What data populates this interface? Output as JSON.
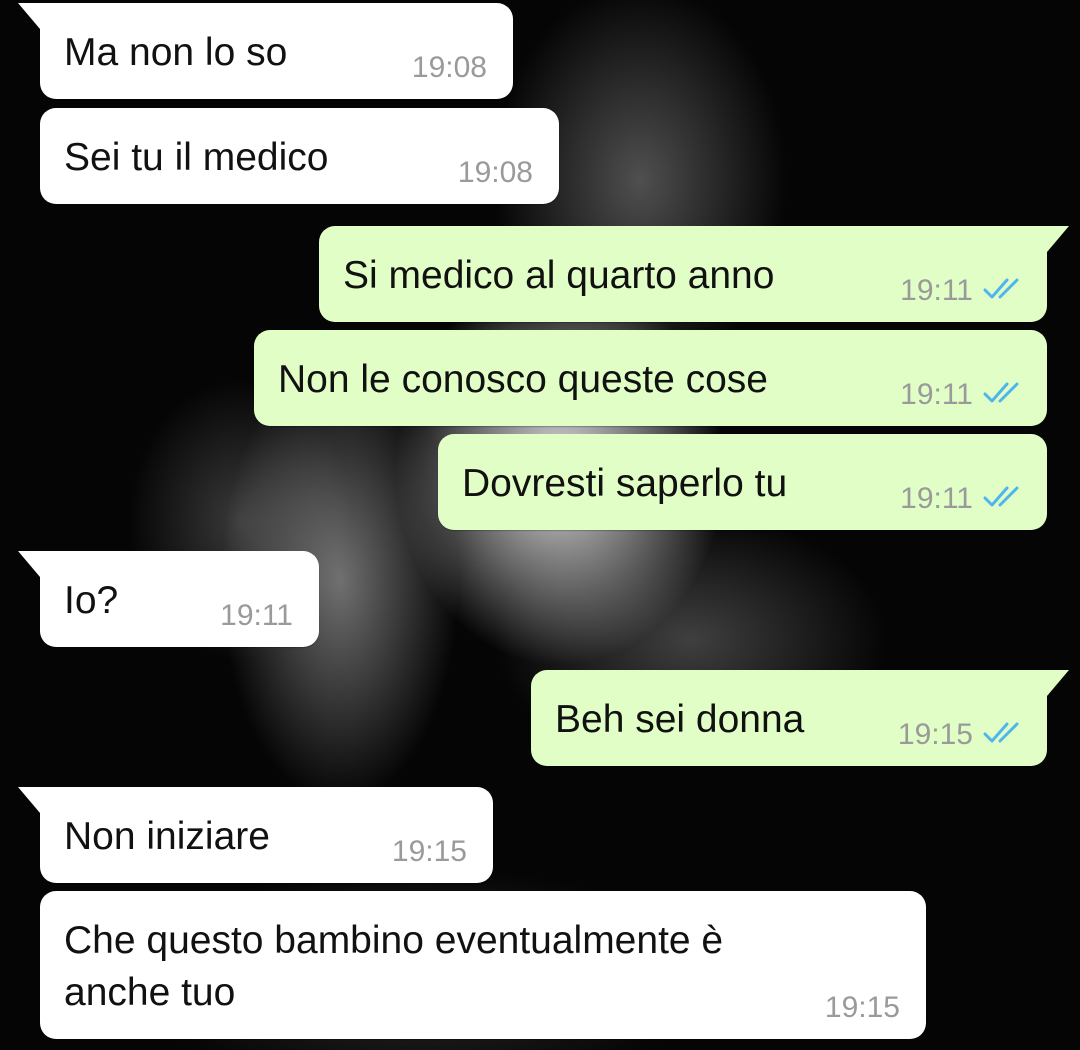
{
  "theme": {
    "incoming_bubble": "#ffffff",
    "outgoing_bubble": "#e1fec6",
    "timestamp_color": "#9a9a9a",
    "read_tick_color": "#4fb6ec"
  },
  "messages": [
    {
      "direction": "in",
      "text": "Ma non lo so",
      "time": "19:08"
    },
    {
      "direction": "in",
      "text": "Sei tu il medico",
      "time": "19:08"
    },
    {
      "direction": "out",
      "text": "Si medico al quarto anno",
      "time": "19:11",
      "status_icon": "double-check-read-icon"
    },
    {
      "direction": "out",
      "text": "Non le conosco queste cose",
      "time": "19:11",
      "status_icon": "double-check-read-icon"
    },
    {
      "direction": "out",
      "text": "Dovresti saperlo tu",
      "time": "19:11",
      "status_icon": "double-check-read-icon"
    },
    {
      "direction": "in",
      "text": "Io?",
      "time": "19:11"
    },
    {
      "direction": "out",
      "text": "Beh sei donna",
      "time": "19:15",
      "status_icon": "double-check-read-icon"
    },
    {
      "direction": "in",
      "text": "Non iniziare",
      "time": "19:15"
    },
    {
      "direction": "in",
      "text": "Che questo bambino eventualmente è anche tuo",
      "time": "19:15"
    }
  ]
}
